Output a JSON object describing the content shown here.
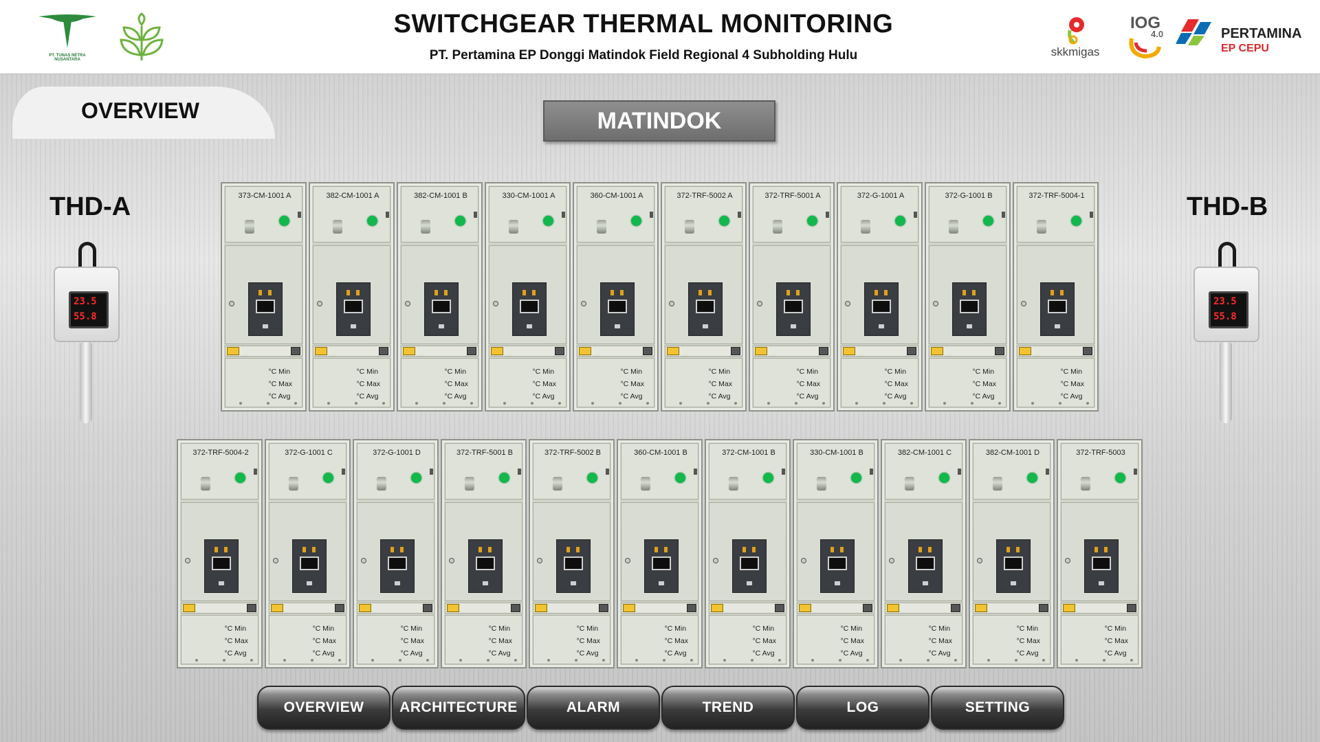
{
  "header": {
    "title": "SWITCHGEAR THERMAL MONITORING",
    "subtitle": "PT. Pertamina EP Donggi Matindok Field Regional 4 Subholding Hulu",
    "logo_left_text": "PT. TUNAS NETRA NUSANTARA",
    "logo_skk": "skkmigas",
    "logo_iog": "IOG",
    "logo_iog_sub": "4.0",
    "logo_pertamina": "PERTAMINA",
    "logo_pertamina_sub": "EP CEPU"
  },
  "page_tab": "OVERVIEW",
  "station": "MATINDOK",
  "thd_a": {
    "label": "THD-A",
    "temp": "23.5",
    "hum": "55.8"
  },
  "thd_b": {
    "label": "THD-B",
    "temp": "23.5",
    "hum": "55.8"
  },
  "stat_labels": {
    "min": "°C Min",
    "max": "°C Max",
    "avg": "°C Avg"
  },
  "panels_row1": [
    {
      "name": "373-CM-1001 A"
    },
    {
      "name": "382-CM-1001 A"
    },
    {
      "name": "382-CM-1001 B"
    },
    {
      "name": "330-CM-1001 A"
    },
    {
      "name": "360-CM-1001 A"
    },
    {
      "name": "372-TRF-5002 A"
    },
    {
      "name": "372-TRF-5001 A"
    },
    {
      "name": "372-G-1001 A"
    },
    {
      "name": "372-G-1001 B"
    },
    {
      "name": "372-TRF-5004-1"
    }
  ],
  "panels_row2": [
    {
      "name": "372-TRF-5004-2"
    },
    {
      "name": "372-G-1001 C"
    },
    {
      "name": "372-G-1001 D"
    },
    {
      "name": "372-TRF-5001 B"
    },
    {
      "name": "372-TRF-5002 B"
    },
    {
      "name": "360-CM-1001 B"
    },
    {
      "name": "372-CM-1001 B"
    },
    {
      "name": "330-CM-1001 B"
    },
    {
      "name": "382-CM-1001 C"
    },
    {
      "name": "382-CM-1001 D"
    },
    {
      "name": "372-TRF-5003"
    }
  ],
  "colors": {
    "status_on": "#12b84c",
    "panel": "#cfd3c8",
    "nav": "#3b3b3b"
  },
  "nav": [
    {
      "label": "OVERVIEW"
    },
    {
      "label": "ARCHITECTURE"
    },
    {
      "label": "ALARM"
    },
    {
      "label": "TREND"
    },
    {
      "label": "LOG"
    },
    {
      "label": "SETTING"
    }
  ]
}
